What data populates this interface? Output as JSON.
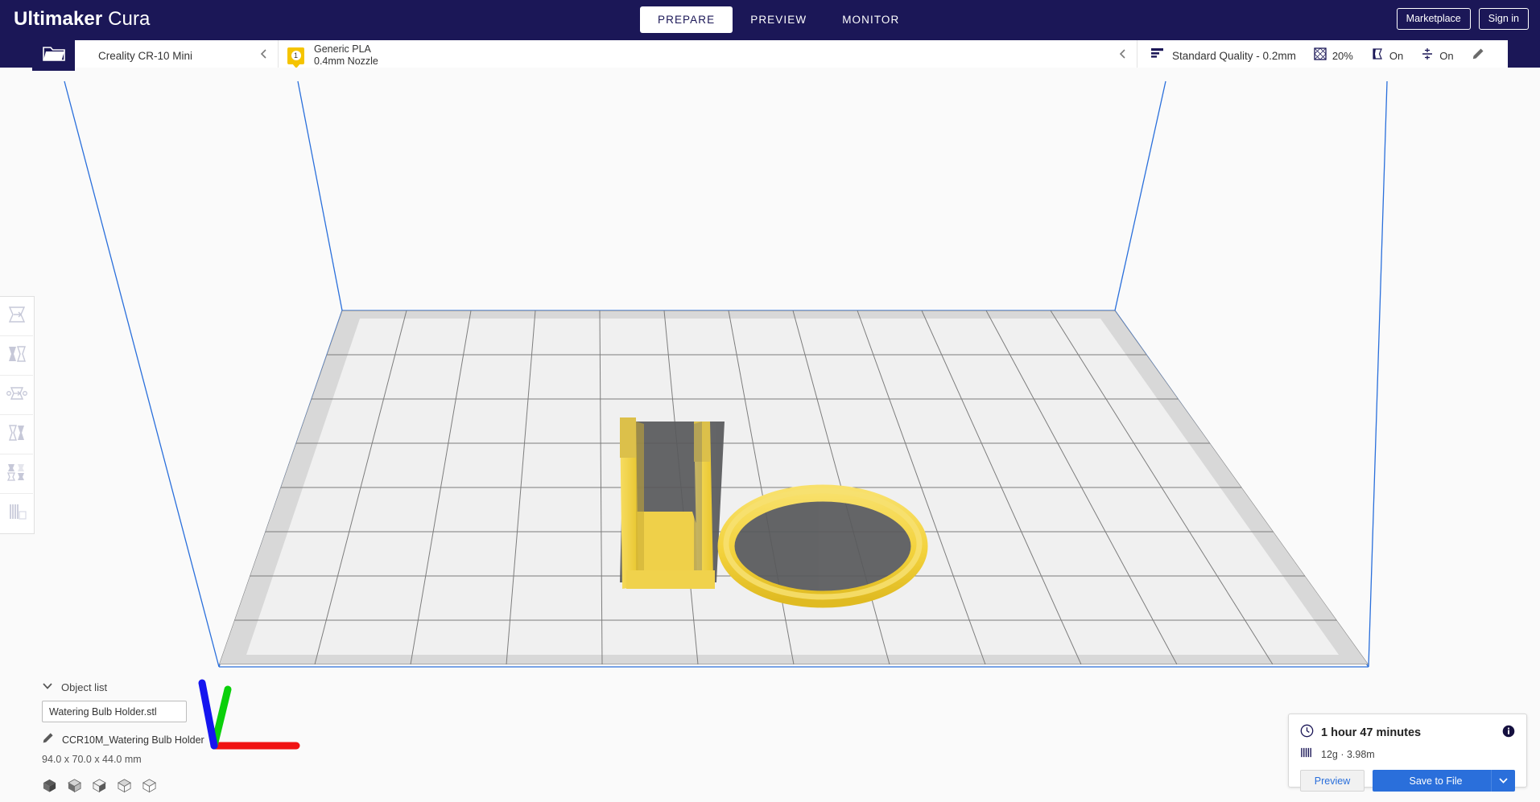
{
  "app": {
    "brand_bold": "Ultimaker",
    "brand_light": "Cura"
  },
  "tabs": [
    {
      "label": "PREPARE",
      "active": true
    },
    {
      "label": "PREVIEW",
      "active": false
    },
    {
      "label": "MONITOR",
      "active": false
    }
  ],
  "topright": {
    "marketplace": "Marketplace",
    "signin": "Sign in"
  },
  "config": {
    "open_file_icon": "folder-open-icon",
    "printer": {
      "name": "Creality CR-10 Mini",
      "chevron": "chevron-left-icon"
    },
    "material": {
      "extruder_number": "1",
      "name": "Generic PLA",
      "nozzle": "0.4mm Nozzle",
      "chevron": "chevron-left-icon"
    },
    "settings": {
      "quality_icon": "layer-height-icon",
      "quality": "Standard Quality - 0.2mm",
      "infill_icon": "infill-icon",
      "infill": "20%",
      "support_icon": "support-icon",
      "support": "On",
      "adhesion_icon": "adhesion-icon",
      "adhesion": "On",
      "edit_icon": "pencil-icon"
    }
  },
  "left_toolbar": [
    {
      "name": "move-tool",
      "icon": "move-icon"
    },
    {
      "name": "scale-tool",
      "icon": "scale-icon"
    },
    {
      "name": "rotate-tool",
      "icon": "rotate-icon"
    },
    {
      "name": "mirror-tool",
      "icon": "mirror-icon"
    },
    {
      "name": "per-model-settings-tool",
      "icon": "per-model-settings-icon"
    },
    {
      "name": "support-blocker-tool",
      "icon": "support-blocker-icon"
    }
  ],
  "object_list": {
    "title": "Object list",
    "collapse_icon": "chevron-down-icon",
    "filename": "Watering Bulb Holder.stl",
    "edit_icon": "pencil-icon",
    "object_name": "CCR10M_Watering Bulb Holder",
    "dimensions": "94.0 x 70.0 x 44.0 mm",
    "view_buttons": [
      "view-3d-icon",
      "view-front-icon",
      "view-top-icon",
      "view-left-icon",
      "view-right-icon"
    ]
  },
  "print_info": {
    "time_icon": "clock-icon",
    "time": "1 hour 47 minutes",
    "info_icon": "info-icon",
    "material_icon": "filament-icon",
    "material": "12g · 3.98m",
    "preview_label": "Preview",
    "save_label": "Save to File",
    "save_dropdown_icon": "chevron-down-icon"
  },
  "colors": {
    "header": "#1b1757",
    "accent": "#2a6fdb",
    "model": "#f4d53f",
    "extruder_badge": "#f5c400",
    "viewport_bg": "#fafafa"
  }
}
